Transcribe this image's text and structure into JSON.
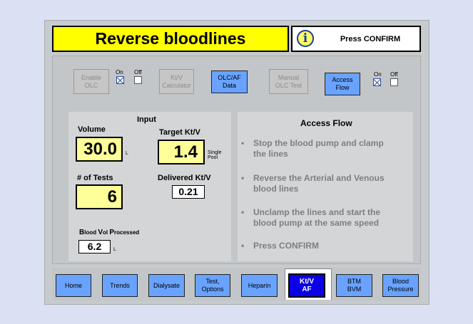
{
  "header": {
    "title": "Reverse bloodlines",
    "message": "Press CONFIRM",
    "icon": "info-icon"
  },
  "toolbar": {
    "enable_olc": "Enable\nOLC",
    "olc_on": "On",
    "olc_off": "Off",
    "ktv_calculator": "Kt/V\nCalculator",
    "olc_af_data": "OLC/AF\nData",
    "manual_olc_test": "Manual\nOLC Test",
    "access_flow": "Access\nFlow",
    "af_on": "On",
    "af_off": "Off"
  },
  "input": {
    "heading": "Input",
    "volume_label": "Volume",
    "volume_value": "30.0",
    "volume_unit": "L",
    "target_ktv_label": "Target Kt/V",
    "target_ktv_value": "1.4",
    "target_ktv_unit": "Single\nPool",
    "tests_label": "# of Tests",
    "tests_value": "6",
    "delivered_ktv_label": "Delivered Kt/V",
    "delivered_ktv_value": "0.21",
    "blood_vol_label_b": "B",
    "blood_vol_label_rest1": "lood ",
    "blood_vol_label_v": "V",
    "blood_vol_label_rest2": "ol ",
    "blood_vol_label_p": "P",
    "blood_vol_label_rest3": "rocessed",
    "blood_vol_value": "6.2",
    "blood_vol_unit": "L"
  },
  "access_flow": {
    "heading": "Access Flow",
    "bullet": "•",
    "steps": [
      "Stop the blood pump and clamp\nthe lines",
      "Reverse the Arterial and Venous\nblood lines",
      "Unclamp the lines and start the\nblood pump at the same speed",
      "Press CONFIRM"
    ]
  },
  "tabs": [
    "Home",
    "Trends",
    "Dialysate",
    "Test,\nOptions",
    "Heparin",
    "Kt/V\nAF",
    "BTM\nBVM",
    "Blood\nPressure"
  ],
  "colors": {
    "title_bg": "#ffff00",
    "button_blue": "#69a3ff",
    "active_tab": "#0c00e6",
    "value_bg": "#ffff99"
  }
}
